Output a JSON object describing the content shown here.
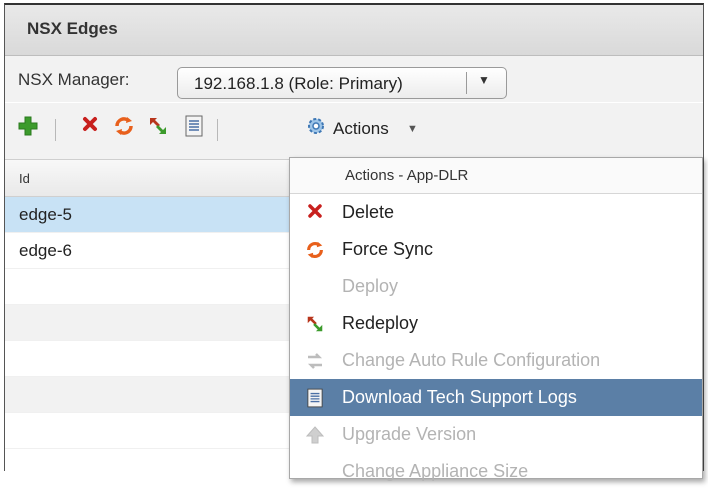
{
  "panel": {
    "title": "NSX Edges"
  },
  "manager": {
    "label": "NSX Manager:",
    "selected": "192.168.1.8 (Role: Primary)"
  },
  "toolbar": {
    "icons": [
      "add-icon",
      "delete-icon",
      "sync-icon",
      "redeploy-icon",
      "tech-logs-icon",
      "gear-icon"
    ],
    "actions_label": "Actions"
  },
  "grid": {
    "columns": [
      "Id"
    ],
    "rows": [
      "edge-5",
      "edge-6",
      "",
      "",
      "",
      "",
      ""
    ],
    "selected_row": "edge-5"
  },
  "menu": {
    "header": "Actions - App-DLR",
    "items": [
      {
        "label": "Delete",
        "icon": "delete-icon",
        "enabled": true
      },
      {
        "label": "Force Sync",
        "icon": "sync-icon",
        "enabled": true
      },
      {
        "label": "Deploy",
        "icon": "",
        "enabled": false
      },
      {
        "label": "Redeploy",
        "icon": "redeploy-icon",
        "enabled": true
      },
      {
        "label": "Change Auto Rule Configuration",
        "icon": "change-rule-icon",
        "enabled": false
      },
      {
        "label": "Download Tech Support Logs",
        "icon": "tech-logs-icon",
        "enabled": true,
        "highlighted": true
      },
      {
        "label": "Upgrade Version",
        "icon": "upgrade-icon",
        "enabled": false
      },
      {
        "label": "Change Appliance Size",
        "icon": "",
        "enabled": false
      }
    ]
  },
  "colors": {
    "highlight": "#5b7fa6",
    "selected_row": "#c8e2f5",
    "green": "#3c9b2c",
    "red": "#c8201e",
    "orange": "#e8601c"
  }
}
